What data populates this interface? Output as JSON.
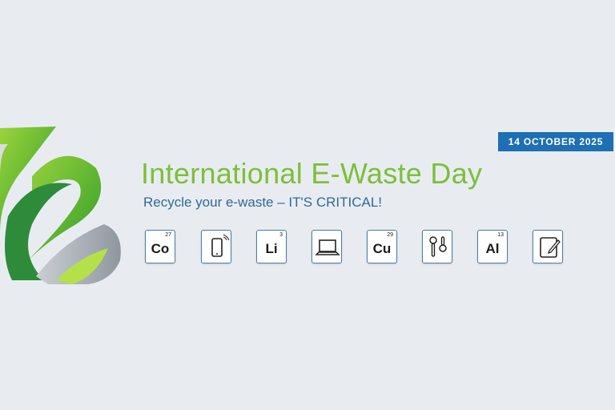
{
  "banner": {
    "date": "14 OCTOBER 2025",
    "title": "International E-Waste Day",
    "subtitle": "Recycle your e-waste – IT'S CRITICAL!",
    "colors": {
      "title": "#7cbf3a",
      "subtitle": "#2f6a96",
      "badge": "#1e6fb3",
      "tile_border": "#4a7fa8"
    }
  },
  "tiles": [
    {
      "type": "element",
      "symbol": "Co",
      "number": "27"
    },
    {
      "type": "icon",
      "icon": "smartphone-icon"
    },
    {
      "type": "element",
      "symbol": "Li",
      "number": "3"
    },
    {
      "type": "icon",
      "icon": "laptop-icon"
    },
    {
      "type": "element",
      "symbol": "Cu",
      "number": "29"
    },
    {
      "type": "icon",
      "icon": "earbuds-icon"
    },
    {
      "type": "element",
      "symbol": "Al",
      "number": "13"
    },
    {
      "type": "icon",
      "icon": "tablet-pen-icon"
    }
  ]
}
